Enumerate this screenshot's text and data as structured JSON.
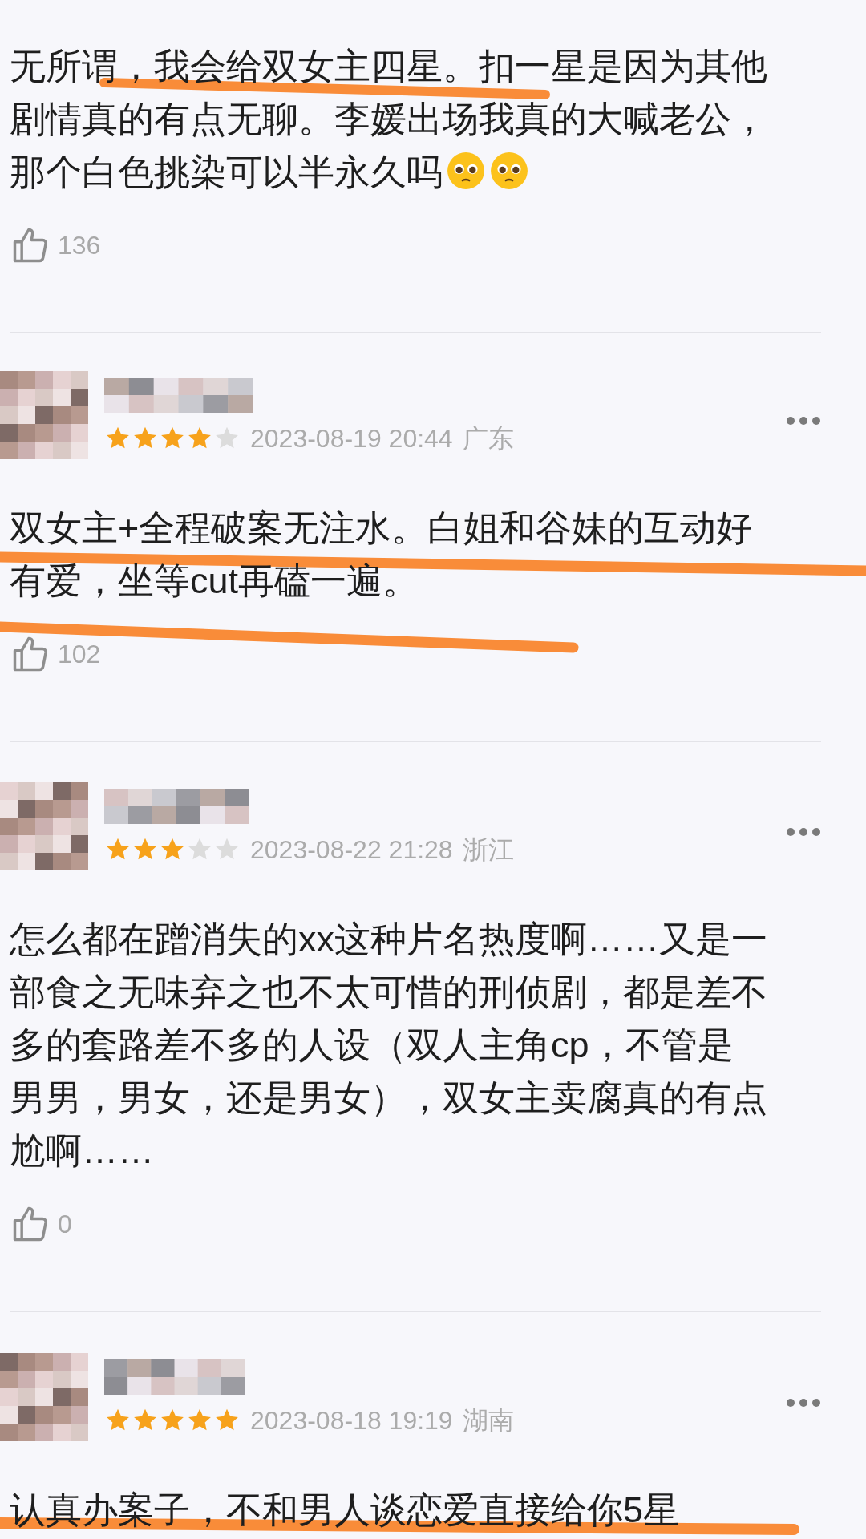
{
  "reviews": [
    {
      "text_lines": [
        "无所谓，我会给双女主四星。扣一星是因为其他",
        "剧情真的有点无聊。李媛出场我真的大喊老公，",
        "那个白色挑染可以半永久吗"
      ],
      "trailing_icons": [
        {
          "kind": "pleading-face"
        },
        {
          "kind": "pleading-face"
        }
      ],
      "likes": "136",
      "highlighted": true
    },
    {
      "stars": 4,
      "time": "2023-08-19 20:44",
      "region": "广东",
      "text_lines": [
        "双女主+全程破案无注水。白姐和谷妹的互动好",
        "有爱，坐等cut再磕一遍。"
      ],
      "likes": "102",
      "highlighted": true
    },
    {
      "stars": 3,
      "time": "2023-08-22 21:28",
      "region": "浙江",
      "text_lines": [
        "怎么都在蹭消失的xx这种片名热度啊……又是一",
        "部食之无味弃之也不太可惜的刑侦剧，都是差不",
        "多的套路差不多的人设（双人主角cp，不管是",
        "男男，男女，还是男女），双女主卖腐真的有点",
        "尬啊……"
      ],
      "likes": "0"
    },
    {
      "stars": 5,
      "time": "2023-08-18 19:19",
      "region": "湖南",
      "text_lines": [
        "认真办案子，不和男人谈恋爱直接给你5星"
      ],
      "highlighted": true
    }
  ]
}
